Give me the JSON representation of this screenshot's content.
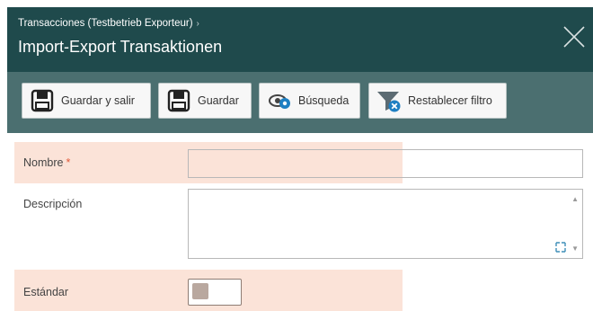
{
  "header": {
    "breadcrumb": "Transacciones (Testbetrieb Exporteur)",
    "breadcrumb_sep": "›",
    "title": "Import-Export Transaktionen"
  },
  "toolbar": {
    "buttons": [
      {
        "label": "Guardar y salir",
        "icon": "save-icon"
      },
      {
        "label": "Guardar",
        "icon": "save-icon"
      },
      {
        "label": "Búsqueda",
        "icon": "binoculars-icon"
      },
      {
        "label": "Restablecer filtro",
        "icon": "filter-reset-icon"
      }
    ]
  },
  "form": {
    "fields": [
      {
        "label": "Nombre",
        "required_mark": "*",
        "value": ""
      },
      {
        "label": "Descripción",
        "value": ""
      },
      {
        "label": "Estándar",
        "checked": false
      }
    ]
  },
  "colors": {
    "header_bg": "#1f4a4c",
    "toolbar_bg": "#4b6f70",
    "highlight": "#fbe3d8",
    "required": "#e05a3a"
  }
}
